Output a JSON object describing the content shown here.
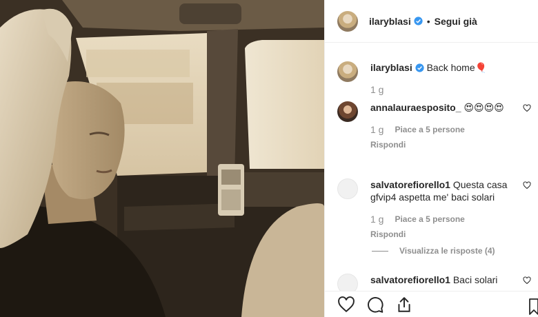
{
  "post": {
    "image_alt": "Sepia photo of a woman with a ponytail sitting in a car",
    "author": "ilaryblasi",
    "separator": "•",
    "follow_label": "Segui già"
  },
  "comments": [
    {
      "user": "ilaryblasi",
      "text": "Back home",
      "emoji": "🎈",
      "time": "1 g",
      "verified": true
    },
    {
      "user": "annalauraesposito_",
      "text": "😍😍😍😍",
      "time": "1 g",
      "likes": "Piace a 5 persone",
      "reply": "Rispondi"
    },
    {
      "user": "salvatorefiorello1",
      "text": "Questa casa gfvip4 aspetta me' baci solari",
      "time": "1 g",
      "likes": "Piace a 5 persone",
      "reply": "Rispondi",
      "view_replies": "Visualizza le risposte (4)"
    },
    {
      "user": "salvatorefiorello1",
      "text": "Baci solari"
    }
  ],
  "icons": {
    "like": "heart-icon",
    "comment": "comment-icon",
    "share": "share-icon",
    "save": "bookmark-icon",
    "verified": "verified-badge-icon"
  },
  "colors": {
    "verified_blue": "#3897f0",
    "muted_text": "#8e8e8e",
    "text": "#262626",
    "divider": "#efefef"
  }
}
